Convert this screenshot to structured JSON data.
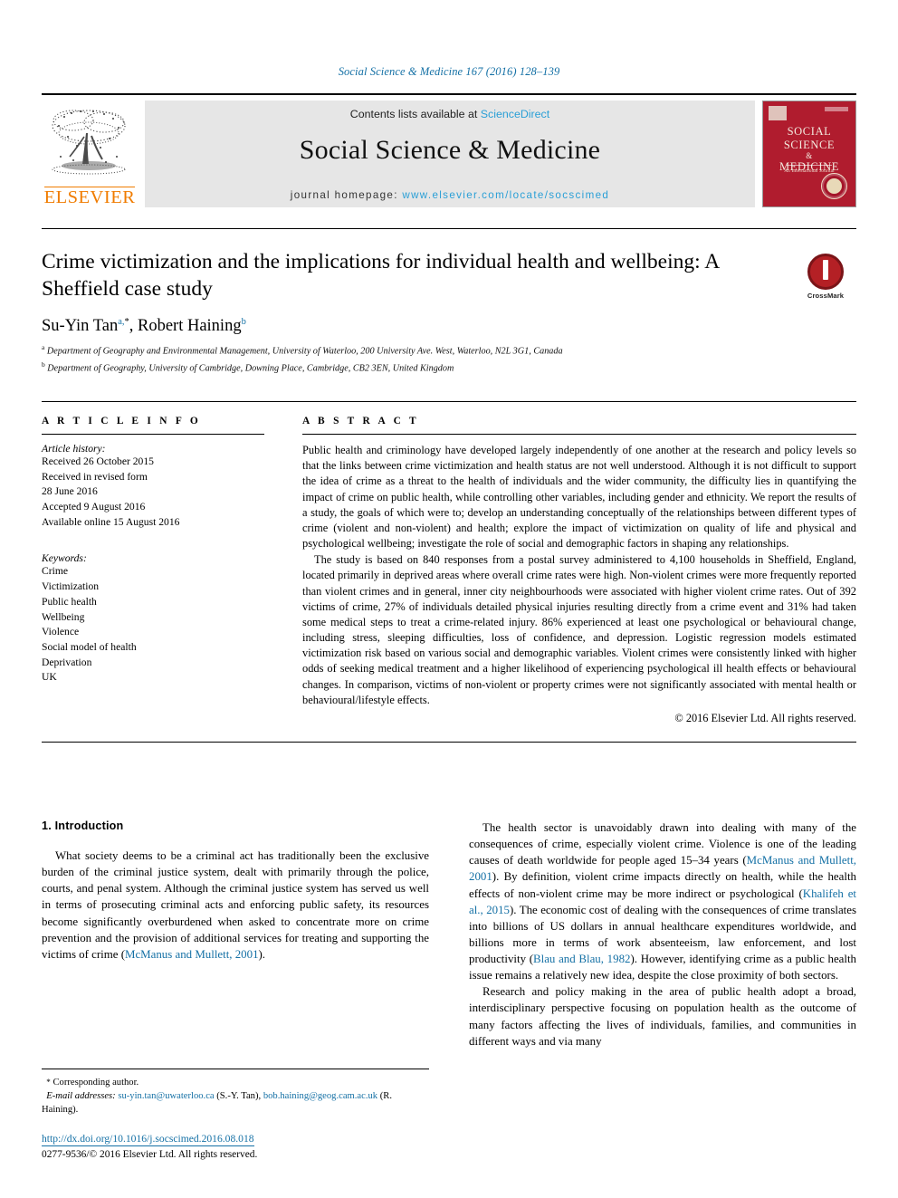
{
  "running_head": "Social Science & Medicine 167 (2016) 128–139",
  "masthead": {
    "contents_prefix": "Contents lists available at ",
    "sciencedirect": "ScienceDirect",
    "journal_name": "Social Science & Medicine",
    "homepage_prefix": "journal homepage: ",
    "homepage_url": "www.elsevier.com/locate/socscimed",
    "publisher": "ELSEVIER",
    "cover": {
      "line1": "SOCIAL",
      "line2": "SCIENCE",
      "amp": "&",
      "line3": "MEDICINE",
      "subtitle": "An International Journal"
    }
  },
  "article": {
    "title": "Crime victimization and the implications for individual health and wellbeing: A Sheffield case study",
    "crossmark_label": "CrossMark",
    "authors": [
      {
        "name": "Su-Yin Tan",
        "marks": "a,",
        "star": "*"
      },
      {
        "name": "Robert Haining",
        "marks": "b",
        "star": ""
      }
    ],
    "authors_separator": ", ",
    "affiliations": [
      {
        "mark": "a",
        "text": "Department of Geography and Environmental Management, University of Waterloo, 200 University Ave. West, Waterloo, N2L 3G1, Canada"
      },
      {
        "mark": "b",
        "text": "Department of Geography, University of Cambridge, Downing Place, Cambridge, CB2 3EN, United Kingdom"
      }
    ]
  },
  "article_info": {
    "heading": "A R T I C L E  I N F O",
    "history_label": "Article history:",
    "history": [
      "Received 26 October 2015",
      "Received in revised form",
      "28 June 2016",
      "Accepted 9 August 2016",
      "Available online 15 August 2016"
    ],
    "keywords_label": "Keywords:",
    "keywords": [
      "Crime",
      "Victimization",
      "Public health",
      "Wellbeing",
      "Violence",
      "Social model of health",
      "Deprivation",
      "UK"
    ]
  },
  "abstract": {
    "heading": "A B S T R A C T",
    "paragraph1": "Public health and criminology have developed largely independently of one another at the research and policy levels so that the links between crime victimization and health status are not well understood. Although it is not difficult to support the idea of crime as a threat to the health of individuals and the wider community, the difficulty lies in quantifying the impact of crime on public health, while controlling other variables, including gender and ethnicity. We report the results of a study, the goals of which were to; develop an understanding conceptually of the relationships between different types of crime (violent and non-violent) and health; explore the impact of victimization on quality of life and physical and psychological wellbeing; investigate the role of social and demographic factors in shaping any relationships.",
    "paragraph2": "The study is based on 840 responses from a postal survey administered to 4,100 households in Sheffield, England, located primarily in deprived areas where overall crime rates were high. Non-violent crimes were more frequently reported than violent crimes and in general, inner city neighbourhoods were associated with higher violent crime rates. Out of 392 victims of crime, 27% of individuals detailed physical injuries resulting directly from a crime event and 31% had taken some medical steps to treat a crime-related injury. 86% experienced at least one psychological or behavioural change, including stress, sleeping difficulties, loss of confidence, and depression. Logistic regression models estimated victimization risk based on various social and demographic variables. Violent crimes were consistently linked with higher odds of seeking medical treatment and a higher likelihood of experiencing psychological ill health effects or behavioural changes. In comparison, victims of non-violent or property crimes were not significantly associated with mental health or behavioural/lifestyle effects.",
    "copyright": "© 2016 Elsevier Ltd. All rights reserved."
  },
  "body": {
    "section_number_title": "1. Introduction",
    "left_paragraphs": [
      {
        "before": "What society deems to be a criminal act has traditionally been the exclusive burden of the criminal justice system, dealt with primarily through the police, courts, and penal system. Although the criminal justice system has served us well in terms of prosecuting criminal acts and enforcing public safety, its resources become significantly overburdened when asked to concentrate more on crime prevention and the provision of additional services for treating and supporting the victims of crime (",
        "ref": "McManus and Mullett, 2001",
        "after": ")."
      }
    ],
    "right_paragraphs": [
      {
        "part1": "The health sector is unavoidably drawn into dealing with many of the consequences of crime, especially violent crime. Violence is one of the leading causes of death worldwide for people aged 15–34 years (",
        "ref1": "McManus and Mullett, 2001",
        "part2": "). By definition, violent crime impacts directly on health, while the health effects of non-violent crime may be more indirect or psychological (",
        "ref2": "Khalifeh et al., 2015",
        "part3": "). The economic cost of dealing with the consequences of crime translates into billions of US dollars in annual healthcare expenditures worldwide, and billions more in terms of work absenteeism, law enforcement, and lost productivity (",
        "ref3": "Blau and Blau, 1982",
        "part4": "). However, identifying crime as a public health issue remains a relatively new idea, despite the close proximity of both sectors."
      },
      {
        "part1": "Research and policy making in the area of public health adopt a broad, interdisciplinary perspective focusing on population health as the outcome of many factors affecting the lives of individuals, families, and communities in different ways and via many"
      }
    ]
  },
  "footnote": {
    "corresponding_star": "*",
    "corresponding_text": "Corresponding author.",
    "email_label": "E-mail addresses:",
    "email1": "su-yin.tan@uwaterloo.ca",
    "email1_owner": "(S.-Y. Tan)",
    "email_sep": ", ",
    "email2": "bob.haining@geog.cam.ac.uk",
    "email2_owner": "(R. Haining)",
    "period": "."
  },
  "doi_block": {
    "doi": "http://dx.doi.org/10.1016/j.socscimed.2016.08.018",
    "issn": "0277-9536/© 2016 Elsevier Ltd. All rights reserved."
  }
}
